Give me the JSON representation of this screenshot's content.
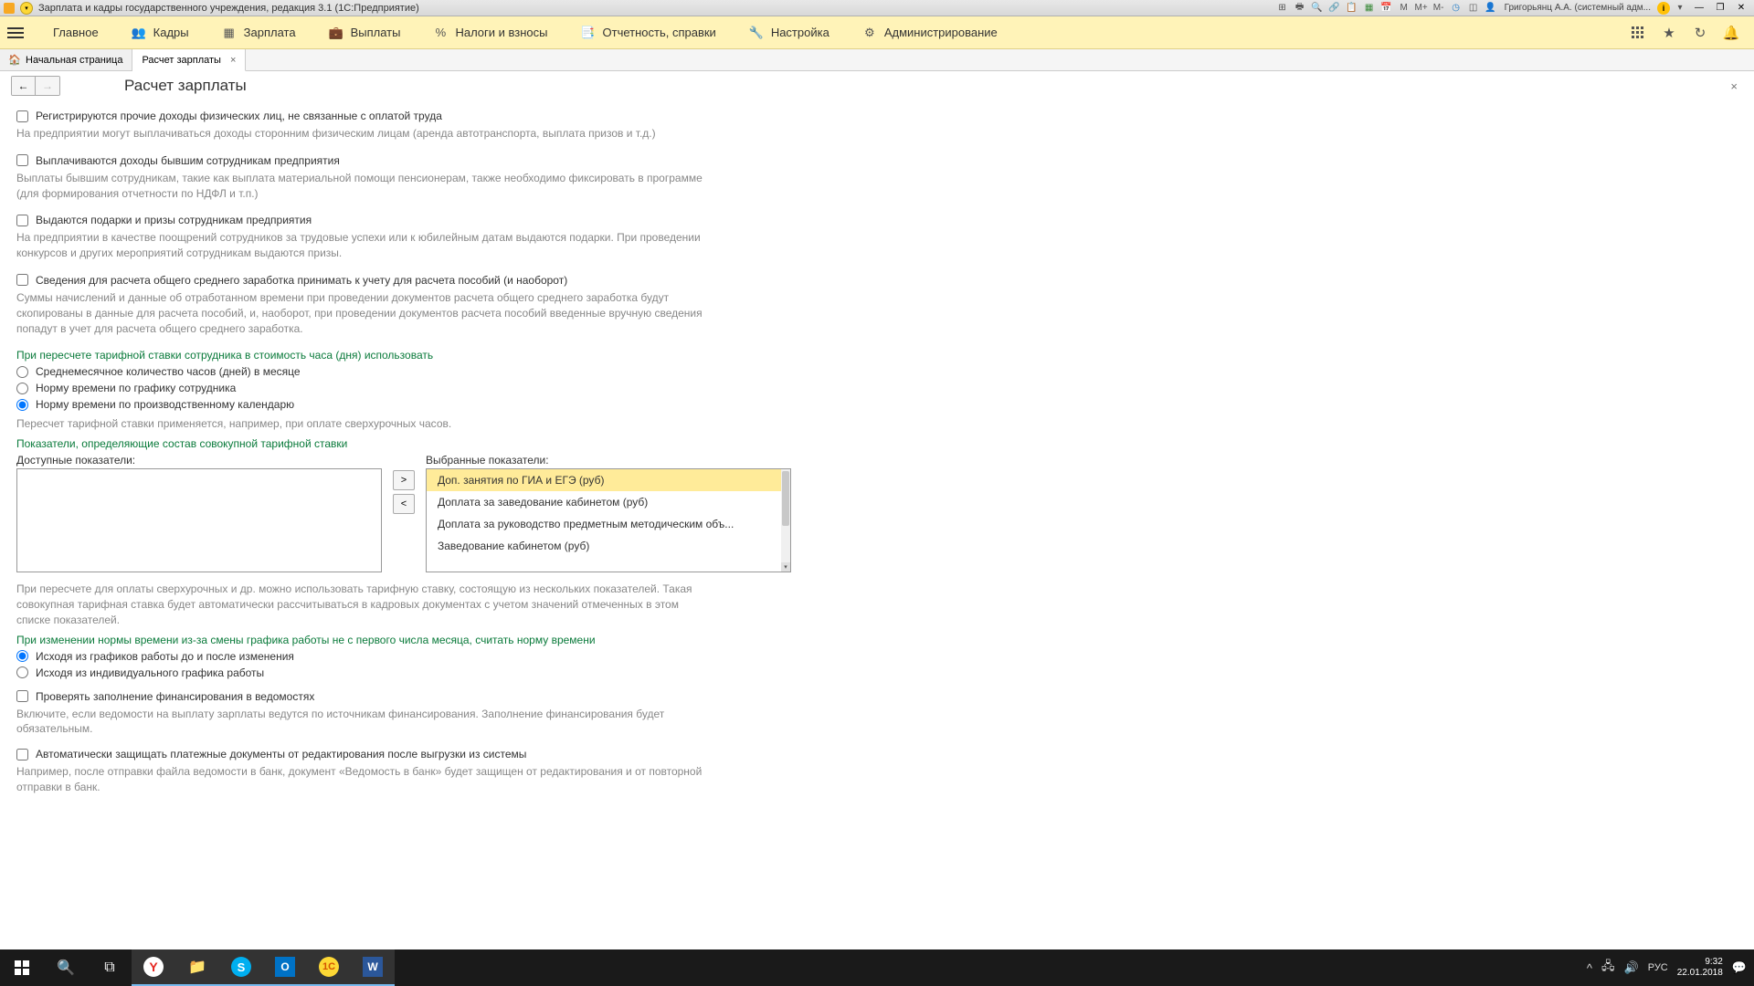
{
  "titlebar": {
    "title": "Зарплата и кадры государственного учреждения, редакция 3.1 (1С:Предприятие)",
    "user": "Григорьянц А.А. (системный адм...",
    "m_labels": [
      "M",
      "M+",
      "M-"
    ]
  },
  "menu": {
    "items": [
      {
        "label": "Главное"
      },
      {
        "label": "Кадры"
      },
      {
        "label": "Зарплата"
      },
      {
        "label": "Выплаты"
      },
      {
        "label": "Налоги и взносы"
      },
      {
        "label": "Отчетность, справки"
      },
      {
        "label": "Настройка"
      },
      {
        "label": "Администрирование"
      }
    ]
  },
  "tabs": {
    "items": [
      {
        "label": "Начальная страница"
      },
      {
        "label": "Расчет зарплаты"
      }
    ]
  },
  "page": {
    "title": "Расчет зарплаты"
  },
  "content": {
    "check1": "Регистрируются прочие доходы физических лиц, не связанные с оплатой труда",
    "hint1": "На предприятии могут выплачиваться доходы сторонним физическим лицам (аренда автотранспорта, выплата призов и т.д.)",
    "check2": "Выплачиваются доходы бывшим сотрудникам предприятия",
    "hint2": "Выплаты бывшим сотрудникам, такие как выплата материальной помощи пенсионерам, также необходимо фиксировать в программе (для формирования отчетности по НДФЛ и т.п.)",
    "check3": "Выдаются подарки и призы сотрудникам предприятия",
    "hint3": "На предприятии в качестве поощрений сотрудников за трудовые успехи или к юбилейным датам выдаются подарки. При проведении конкурсов и других мероприятий сотрудникам выдаются призы.",
    "check4": "Сведения для расчета общего среднего заработка принимать к учету для расчета пособий (и наоборот)",
    "hint4": "Суммы начислений и данные об отработанном времени при проведении документов расчета общего среднего заработка будут скопированы в данные для расчета пособий, и, наоборот, при проведении документов расчета пособий введенные вручную сведения попадут в учет для расчета общего среднего заработка.",
    "section1": "При пересчете тарифной ставки сотрудника в стоимость часа (дня) использовать",
    "radio1": "Среднемесячное количество часов (дней) в месяце",
    "radio2": "Норму времени по графику сотрудника",
    "radio3": "Норму времени по производственному календарю",
    "hint5": "Пересчет тарифной ставки применяется, например, при оплате сверхурочных часов.",
    "section2": "Показатели, определяющие состав совокупной тарифной ставки",
    "available_label": "Доступные показатели:",
    "selected_label": "Выбранные показатели:",
    "selected_items": [
      "Доп. занятия по ГИА и ЕГЭ (руб)",
      "Доплата за заведование кабинетом (руб)",
      "Доплата за руководство предметным методическим объ...",
      "Заведование кабинетом (руб)"
    ],
    "btn_add": ">",
    "btn_remove": "<",
    "hint6": "При пересчете для оплаты сверхурочных и др. можно использовать тарифную ставку, состоящую из нескольких показателей. Такая совокупная тарифная ставка будет автоматически рассчитываться в кадровых документах с учетом значений отмеченных в этом списке показателей.",
    "section3": "При изменении нормы времени из-за смены графика работы не с первого числа месяца, считать норму времени",
    "radio4": "Исходя из графиков работы до и после изменения",
    "radio5": "Исходя из индивидуального графика работы",
    "check5": "Проверять заполнение финансирования в ведомостях",
    "hint7": "Включите, если ведомости на выплату зарплаты ведутся по источникам финансирования. Заполнение финансирования будет обязательным.",
    "check6": "Автоматически защищать платежные документы от редактирования после выгрузки из системы",
    "hint8": "Например, после отправки файла ведомости в банк, документ «Ведомость в банк» будет защищен от редактирования и от повторной отправки в банк."
  },
  "taskbar": {
    "lang": "РУС",
    "time": "9:32",
    "date": "22.01.2018"
  }
}
